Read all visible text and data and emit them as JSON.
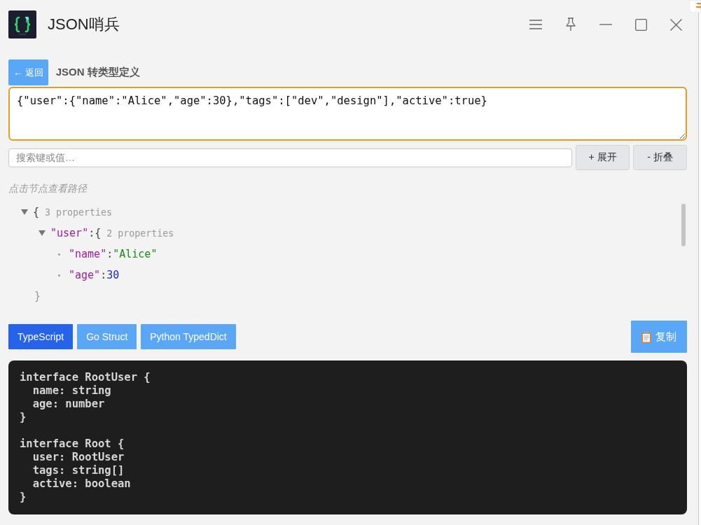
{
  "window": {
    "title": "JSON哨兵"
  },
  "header": {
    "back_button": "← 返回",
    "title": "JSON 转类型定义"
  },
  "json_input": {
    "value": "{\"user\":{\"name\":\"Alice\",\"age\":30},\"tags\":[\"dev\",\"design\"],\"active\":true}",
    "focused": true
  },
  "search": {
    "placeholder": "搜索键或值…"
  },
  "tree_buttons": [
    "+ 展开",
    "- 折叠"
  ],
  "path_hint": "点击节点查看路径",
  "tree": {
    "kind": "object",
    "open": "{",
    "summary": "3 properties",
    "expanded": true,
    "children": [
      {
        "kind": "object",
        "key": "\"user\"",
        "separator": ":",
        "open": "{",
        "summary": "2 properties",
        "expanded": true,
        "close": "}",
        "children": [
          {
            "kind": "string",
            "key": "\"name\"",
            "separator": ":",
            "value": "\"Alice\""
          },
          {
            "kind": "number",
            "key": "\"age\"",
            "separator": ":",
            "value": "30"
          }
        ]
      }
    ]
  },
  "format_tabs": [
    {
      "label": "TypeScript",
      "selected": true
    },
    {
      "label": "Go Struct",
      "selected": false
    },
    {
      "label": "Python TypedDict",
      "selected": false
    }
  ],
  "copy_button": {
    "label": "复制"
  },
  "output": {
    "code": "interface RootUser {\n  name: string\n  age: number\n}\n\ninterface Root {\n  user: RootUser\n  tags: string[]\n  active: boolean\n}"
  }
}
